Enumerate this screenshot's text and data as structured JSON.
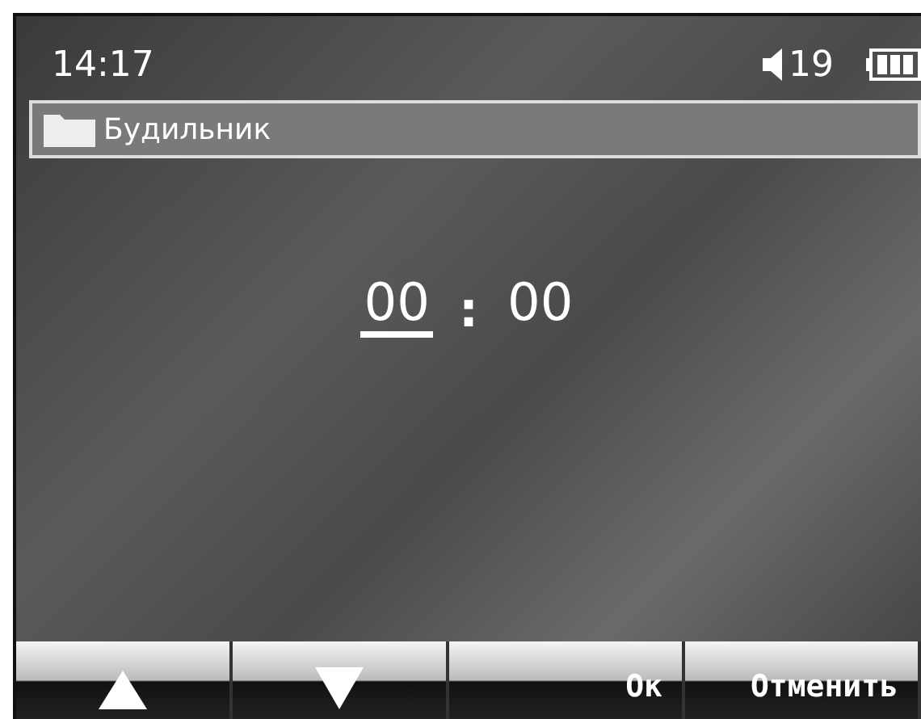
{
  "status_bar": {
    "time": "14:17",
    "volume": "19"
  },
  "title_bar": {
    "title": "Будильник"
  },
  "time_fields": [
    {
      "value": "00",
      "selected": true
    },
    {
      "value": "00",
      "selected": false
    }
  ],
  "separator": ":",
  "softkeys": [
    {
      "kind": "up"
    },
    {
      "kind": "down"
    },
    {
      "kind": "text",
      "label": "Ок"
    },
    {
      "kind": "text",
      "label": "Отменить"
    }
  ]
}
